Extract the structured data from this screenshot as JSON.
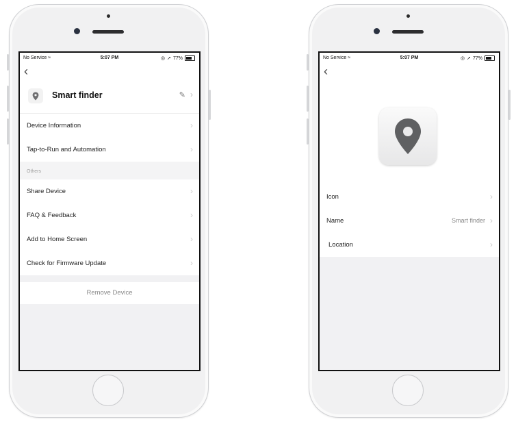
{
  "left_screen": {
    "status": {
      "carrier": "No Service",
      "time": "5:07 PM",
      "battery": "77%"
    },
    "back_glyph": "‹",
    "device_name": "Smart finder",
    "items_top": [
      {
        "label": "Device Information"
      },
      {
        "label": "Tap-to-Run and Automation"
      }
    ],
    "section_label": "Others",
    "items_others": [
      {
        "label": "Share Device"
      },
      {
        "label": "FAQ & Feedback"
      },
      {
        "label": "Add to Home Screen"
      },
      {
        "label": "Check for Firmware Update"
      }
    ],
    "remove_label": "Remove Device"
  },
  "right_screen": {
    "status": {
      "carrier": "No Service",
      "time": "5:07 PM",
      "battery": "77%"
    },
    "back_glyph": "‹",
    "rows": [
      {
        "label": "Icon",
        "value": ""
      },
      {
        "label": "Name",
        "value": "Smart finder"
      },
      {
        "label": "Location",
        "value": ""
      }
    ]
  },
  "icons": {
    "device": "location-pin-icon",
    "edit": "pencil-icon",
    "chevron": "chevron-right-icon",
    "back": "back-arrow-icon"
  },
  "colors": {
    "pin": "#6e6e70",
    "pin_large": "#5f6062",
    "screen_bg": "#f1f1f3"
  }
}
